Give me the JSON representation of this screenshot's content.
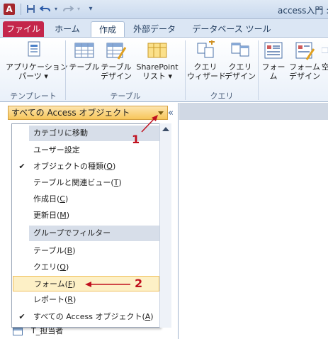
{
  "window": {
    "title": "access入門 :"
  },
  "titlebar": {
    "app_icon": "A",
    "save_icon": "save-icon",
    "undo_icon": "undo-icon",
    "redo_icon": "redo-icon"
  },
  "tabs": [
    {
      "label": "ファイル"
    },
    {
      "label": "ホーム"
    },
    {
      "label": "作成"
    },
    {
      "label": "外部データ"
    },
    {
      "label": "データベース ツール"
    }
  ],
  "ribbon": {
    "buttons": [
      {
        "label": "アプリケーション\nパーツ ▾"
      },
      {
        "label": "テーブル"
      },
      {
        "label": "テーブル\nデザイン"
      },
      {
        "label": "SharePoint\nリスト ▾"
      },
      {
        "label": "クエリ\nウィザード"
      },
      {
        "label": "クエリ\nデザイン"
      },
      {
        "label": "フォーム"
      },
      {
        "label": "フォーム\nデザイン"
      },
      {
        "label": "空"
      }
    ],
    "groups": [
      {
        "label": "テンプレート"
      },
      {
        "label": "テーブル"
      },
      {
        "label": "クエリ"
      }
    ]
  },
  "nav": {
    "header": "すべての Access オブジェクト",
    "collapse": "«",
    "bottom_item": "T_担当者"
  },
  "menu": {
    "section1": "カテゴリに移動",
    "section2": "グループでフィルター",
    "items_cat": [
      {
        "text": "ユーザー設定",
        "key": "",
        "checked": false
      },
      {
        "text": "オブジェクトの種類(",
        "key": "O",
        "tail": ")",
        "checked": true
      },
      {
        "text": "テーブルと関連ビュー(",
        "key": "T",
        "tail": ")",
        "checked": false
      },
      {
        "text": "作成日(",
        "key": "C",
        "tail": ")",
        "checked": false
      },
      {
        "text": "更新日(",
        "key": "M",
        "tail": ")",
        "checked": false
      }
    ],
    "items_filter": [
      {
        "text": "テーブル(",
        "key": "B",
        "tail": ")",
        "checked": false
      },
      {
        "text": "クエリ(",
        "key": "Q",
        "tail": ")",
        "checked": false
      },
      {
        "text": "フォーム(",
        "key": "F",
        "tail": ")",
        "checked": false
      },
      {
        "text": "レポート(",
        "key": "R",
        "tail": ")",
        "checked": false
      },
      {
        "text": "すべての Access オブジェクト(",
        "key": "A",
        "tail": ")",
        "checked": true
      }
    ]
  },
  "annotations": {
    "one": "1",
    "two": "2"
  },
  "colors": {
    "file_tab": "#c4264b",
    "highlight": "#fdf0c6",
    "nav_header": "#f7c65a",
    "annotation": "#c0101e"
  }
}
